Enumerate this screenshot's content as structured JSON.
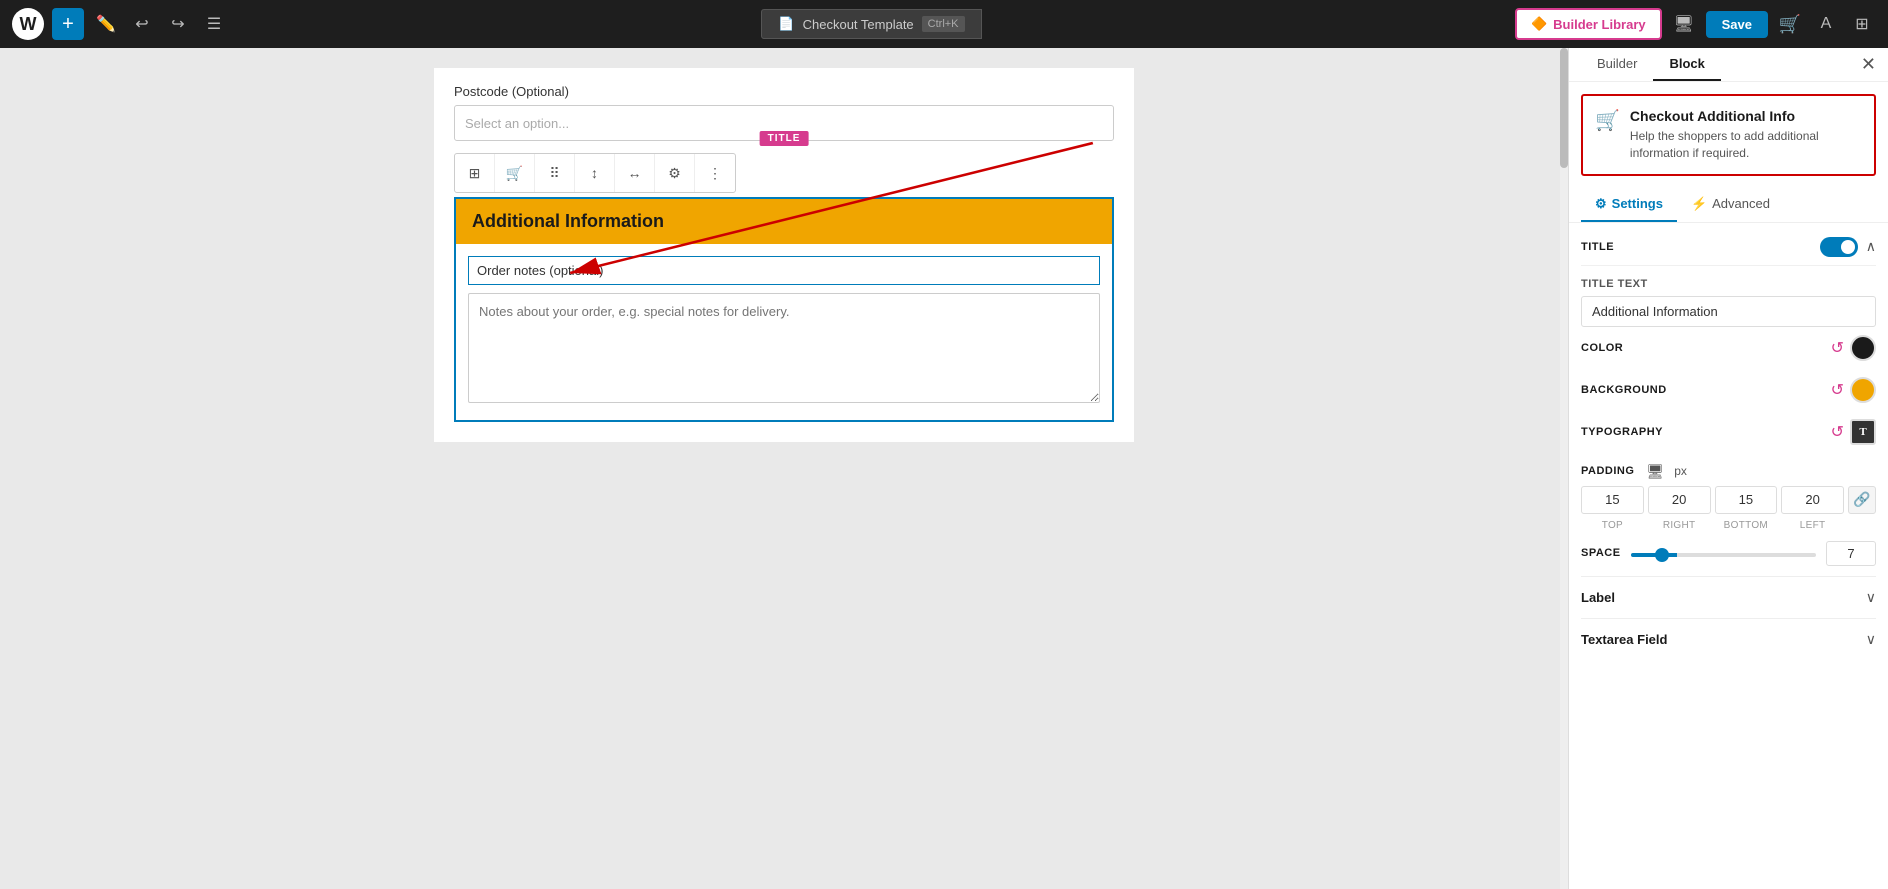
{
  "topbar": {
    "template_label": "Checkout Template",
    "shortcut": "Ctrl+K",
    "builder_lib_label": "Builder Library",
    "save_label": "Save",
    "wp_logo": "W"
  },
  "canvas": {
    "postcode_label": "Postcode (Optional)",
    "postcode_placeholder": "Select an option...",
    "title_badge": "TITLE",
    "block_title": "Additional Information",
    "order_notes_label": "Order notes (optional)",
    "order_notes_placeholder": "Notes about your order, e.g. special notes for delivery."
  },
  "right_panel": {
    "builder_tab": "Builder",
    "block_tab": "Block",
    "settings_tab": "Settings",
    "advanced_tab": "Advanced",
    "info_card": {
      "title": "Checkout Additional Info",
      "description": "Help the shoppers to add additional information if required."
    },
    "title_section": {
      "label": "Title",
      "toggle_on": true
    },
    "title_text_label": "TITLE TEXT",
    "title_text_value": "Additional Information",
    "color_label": "COLOR",
    "background_label": "BACKGROUND",
    "typography_label": "TYPOGRAPHY",
    "padding_label": "PADDING",
    "padding_unit": "px",
    "padding_top": "15",
    "padding_right": "20",
    "padding_bottom": "15",
    "padding_left": "20",
    "top_label": "TOP",
    "right_label": "RIGHT",
    "bottom_label": "BOTTOM",
    "left_label": "LEFT",
    "space_label": "SPACE",
    "space_value": "7",
    "label_section": "Label",
    "textarea_section": "Textarea Field"
  }
}
